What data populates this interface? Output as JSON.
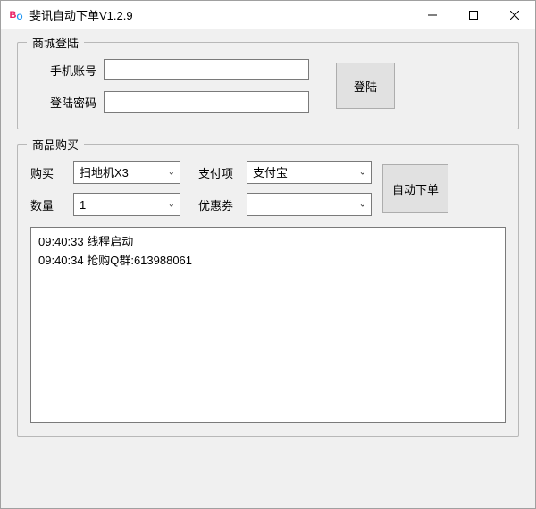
{
  "window": {
    "title": "斐讯自动下单V1.2.9"
  },
  "login": {
    "legend": "商城登陆",
    "phone_label": "手机账号",
    "phone_value": "",
    "password_label": "登陆密码",
    "password_value": "",
    "button_label": "登陆"
  },
  "purchase": {
    "legend": "商品购买",
    "buy_label": "购买",
    "buy_value": "扫地机X3",
    "quantity_label": "数量",
    "quantity_value": "1",
    "payment_label": "支付项",
    "payment_value": "支付宝",
    "coupon_label": "优惠券",
    "coupon_value": "",
    "auto_order_label": "自动下单"
  },
  "log": {
    "lines": [
      "09:40:33  线程启动",
      "09:40:34  抢购Q群:613988061"
    ]
  }
}
